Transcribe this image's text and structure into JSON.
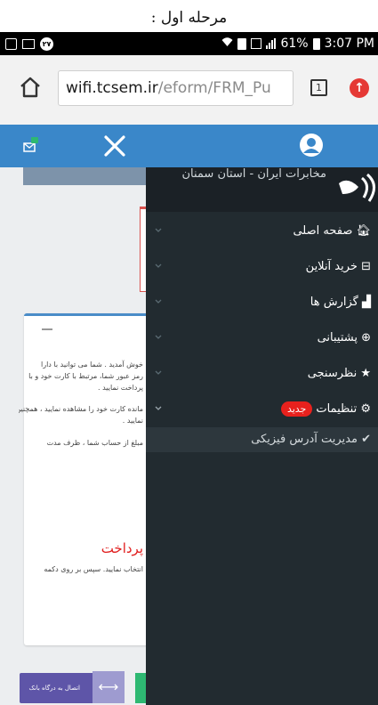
{
  "caption": "مرحله اول :",
  "status_bar": {
    "notification_count": "۲۷",
    "battery": "61%",
    "time": "3:07 PM"
  },
  "browser": {
    "url_domain": "wifi.tcsem.ir",
    "url_path": "/eform/FRM_Pu",
    "tab_count": "1"
  },
  "colors": {
    "header": "#3a87c9",
    "sidebar": "#222b30",
    "badge": "#e8211d"
  },
  "sidebar": {
    "header_title": "مخابرات ایران - استان سمنان",
    "items": [
      {
        "label": "صفحه اصلی",
        "icon": "home-icon"
      },
      {
        "label": "خرید آنلاین",
        "icon": "cart-icon"
      },
      {
        "label": "گزارش ها",
        "icon": "area-chart-icon"
      },
      {
        "label": "پشتیبانی",
        "icon": "life-ring-icon"
      },
      {
        "label": "نظرسنجی",
        "icon": "star-icon"
      },
      {
        "label": "تنظیمات",
        "icon": "gear-icon",
        "badge": "جدید"
      }
    ],
    "subitem": "مدیریت آدرس فیزیکی"
  },
  "content": {
    "card_lines": [
      "خوش آمدید . شما می توانید با دارا",
      "رمز عبور شما، مرتبط با کارت خود و با",
      "پرداخت نمایید .",
      "مانده کارت خود را مشاهده نمایید ، همچنین",
      "نمایید .",
      "مبلغ از حساب شما ، ظرف مدت"
    ],
    "heading": "پرداخت",
    "instruction": "انتخاب نمایید. سپس بر روی دکمه"
  },
  "bottom": {
    "bank_button_label": "اتصال به درگاه بانک"
  }
}
